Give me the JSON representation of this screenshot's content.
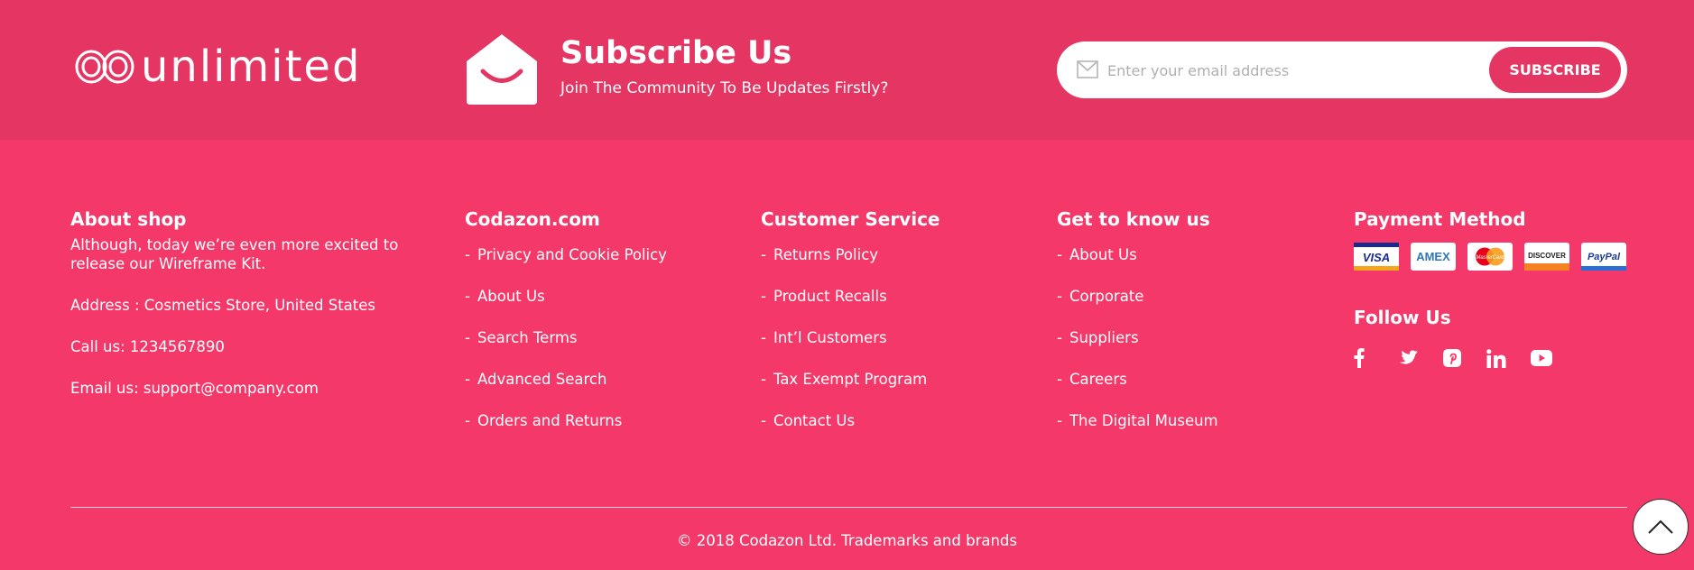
{
  "brand": {
    "logo_text": "unlimited"
  },
  "subscribe": {
    "title": "Subscribe Us",
    "subtitle": "Join The Community To Be Updates Firstly?",
    "email_placeholder": "Enter your email address",
    "button_label": "SUBSCRIBE"
  },
  "about": {
    "heading": "About shop",
    "intro_line1": "Although, today we’re even more excited to",
    "intro_line2": "release our Wireframe Kit.",
    "address": "Address : Cosmetics Store, United States",
    "phone": "Call us: 1234567890",
    "email": "Email us: support@company.com"
  },
  "columns": [
    {
      "heading": "Codazon.com",
      "links": [
        "Privacy and Cookie Policy",
        "About Us",
        "Search Terms",
        "Advanced Search",
        "Orders and Returns"
      ]
    },
    {
      "heading": "Customer Service",
      "links": [
        "Returns Policy",
        "Product Recalls",
        "Int’l Customers",
        "Tax Exempt Program",
        "Contact Us"
      ]
    },
    {
      "heading": "Get to know us",
      "links": [
        "About Us",
        "Corporate",
        "Suppliers",
        "Careers",
        "The Digital Museum"
      ]
    }
  ],
  "link_prefix": "-",
  "payment": {
    "heading": "Payment Method",
    "cards": [
      "VISA",
      "AMEX",
      "MasterCard",
      "DISCOVER",
      "PayPal"
    ]
  },
  "follow": {
    "heading": "Follow Us",
    "icons": [
      "facebook-icon",
      "twitter-icon",
      "pinterest-icon",
      "linkedin-icon",
      "youtube-icon"
    ]
  },
  "copyright": "© 2018 Codazon Ltd. Trademarks and brands",
  "colors": {
    "top_band": "#e43563",
    "footer_bg": "#f5386a",
    "text": "#ffffff"
  }
}
